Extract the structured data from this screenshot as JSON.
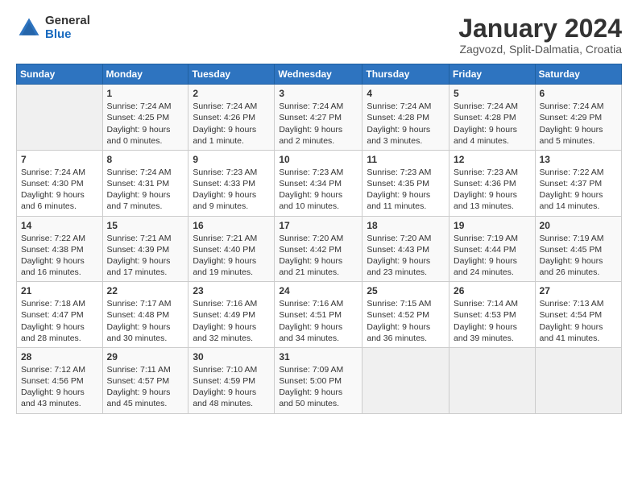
{
  "header": {
    "logo_general": "General",
    "logo_blue": "Blue",
    "month_title": "January 2024",
    "subtitle": "Zagvozd, Split-Dalmatia, Croatia"
  },
  "weekdays": [
    "Sunday",
    "Monday",
    "Tuesday",
    "Wednesday",
    "Thursday",
    "Friday",
    "Saturday"
  ],
  "weeks": [
    [
      {
        "num": "",
        "sunrise": "",
        "sunset": "",
        "daylight": ""
      },
      {
        "num": "1",
        "sunrise": "Sunrise: 7:24 AM",
        "sunset": "Sunset: 4:25 PM",
        "daylight": "Daylight: 9 hours and 0 minutes."
      },
      {
        "num": "2",
        "sunrise": "Sunrise: 7:24 AM",
        "sunset": "Sunset: 4:26 PM",
        "daylight": "Daylight: 9 hours and 1 minute."
      },
      {
        "num": "3",
        "sunrise": "Sunrise: 7:24 AM",
        "sunset": "Sunset: 4:27 PM",
        "daylight": "Daylight: 9 hours and 2 minutes."
      },
      {
        "num": "4",
        "sunrise": "Sunrise: 7:24 AM",
        "sunset": "Sunset: 4:28 PM",
        "daylight": "Daylight: 9 hours and 3 minutes."
      },
      {
        "num": "5",
        "sunrise": "Sunrise: 7:24 AM",
        "sunset": "Sunset: 4:28 PM",
        "daylight": "Daylight: 9 hours and 4 minutes."
      },
      {
        "num": "6",
        "sunrise": "Sunrise: 7:24 AM",
        "sunset": "Sunset: 4:29 PM",
        "daylight": "Daylight: 9 hours and 5 minutes."
      }
    ],
    [
      {
        "num": "7",
        "sunrise": "Sunrise: 7:24 AM",
        "sunset": "Sunset: 4:30 PM",
        "daylight": "Daylight: 9 hours and 6 minutes."
      },
      {
        "num": "8",
        "sunrise": "Sunrise: 7:24 AM",
        "sunset": "Sunset: 4:31 PM",
        "daylight": "Daylight: 9 hours and 7 minutes."
      },
      {
        "num": "9",
        "sunrise": "Sunrise: 7:23 AM",
        "sunset": "Sunset: 4:33 PM",
        "daylight": "Daylight: 9 hours and 9 minutes."
      },
      {
        "num": "10",
        "sunrise": "Sunrise: 7:23 AM",
        "sunset": "Sunset: 4:34 PM",
        "daylight": "Daylight: 9 hours and 10 minutes."
      },
      {
        "num": "11",
        "sunrise": "Sunrise: 7:23 AM",
        "sunset": "Sunset: 4:35 PM",
        "daylight": "Daylight: 9 hours and 11 minutes."
      },
      {
        "num": "12",
        "sunrise": "Sunrise: 7:23 AM",
        "sunset": "Sunset: 4:36 PM",
        "daylight": "Daylight: 9 hours and 13 minutes."
      },
      {
        "num": "13",
        "sunrise": "Sunrise: 7:22 AM",
        "sunset": "Sunset: 4:37 PM",
        "daylight": "Daylight: 9 hours and 14 minutes."
      }
    ],
    [
      {
        "num": "14",
        "sunrise": "Sunrise: 7:22 AM",
        "sunset": "Sunset: 4:38 PM",
        "daylight": "Daylight: 9 hours and 16 minutes."
      },
      {
        "num": "15",
        "sunrise": "Sunrise: 7:21 AM",
        "sunset": "Sunset: 4:39 PM",
        "daylight": "Daylight: 9 hours and 17 minutes."
      },
      {
        "num": "16",
        "sunrise": "Sunrise: 7:21 AM",
        "sunset": "Sunset: 4:40 PM",
        "daylight": "Daylight: 9 hours and 19 minutes."
      },
      {
        "num": "17",
        "sunrise": "Sunrise: 7:20 AM",
        "sunset": "Sunset: 4:42 PM",
        "daylight": "Daylight: 9 hours and 21 minutes."
      },
      {
        "num": "18",
        "sunrise": "Sunrise: 7:20 AM",
        "sunset": "Sunset: 4:43 PM",
        "daylight": "Daylight: 9 hours and 23 minutes."
      },
      {
        "num": "19",
        "sunrise": "Sunrise: 7:19 AM",
        "sunset": "Sunset: 4:44 PM",
        "daylight": "Daylight: 9 hours and 24 minutes."
      },
      {
        "num": "20",
        "sunrise": "Sunrise: 7:19 AM",
        "sunset": "Sunset: 4:45 PM",
        "daylight": "Daylight: 9 hours and 26 minutes."
      }
    ],
    [
      {
        "num": "21",
        "sunrise": "Sunrise: 7:18 AM",
        "sunset": "Sunset: 4:47 PM",
        "daylight": "Daylight: 9 hours and 28 minutes."
      },
      {
        "num": "22",
        "sunrise": "Sunrise: 7:17 AM",
        "sunset": "Sunset: 4:48 PM",
        "daylight": "Daylight: 9 hours and 30 minutes."
      },
      {
        "num": "23",
        "sunrise": "Sunrise: 7:16 AM",
        "sunset": "Sunset: 4:49 PM",
        "daylight": "Daylight: 9 hours and 32 minutes."
      },
      {
        "num": "24",
        "sunrise": "Sunrise: 7:16 AM",
        "sunset": "Sunset: 4:51 PM",
        "daylight": "Daylight: 9 hours and 34 minutes."
      },
      {
        "num": "25",
        "sunrise": "Sunrise: 7:15 AM",
        "sunset": "Sunset: 4:52 PM",
        "daylight": "Daylight: 9 hours and 36 minutes."
      },
      {
        "num": "26",
        "sunrise": "Sunrise: 7:14 AM",
        "sunset": "Sunset: 4:53 PM",
        "daylight": "Daylight: 9 hours and 39 minutes."
      },
      {
        "num": "27",
        "sunrise": "Sunrise: 7:13 AM",
        "sunset": "Sunset: 4:54 PM",
        "daylight": "Daylight: 9 hours and 41 minutes."
      }
    ],
    [
      {
        "num": "28",
        "sunrise": "Sunrise: 7:12 AM",
        "sunset": "Sunset: 4:56 PM",
        "daylight": "Daylight: 9 hours and 43 minutes."
      },
      {
        "num": "29",
        "sunrise": "Sunrise: 7:11 AM",
        "sunset": "Sunset: 4:57 PM",
        "daylight": "Daylight: 9 hours and 45 minutes."
      },
      {
        "num": "30",
        "sunrise": "Sunrise: 7:10 AM",
        "sunset": "Sunset: 4:59 PM",
        "daylight": "Daylight: 9 hours and 48 minutes."
      },
      {
        "num": "31",
        "sunrise": "Sunrise: 7:09 AM",
        "sunset": "Sunset: 5:00 PM",
        "daylight": "Daylight: 9 hours and 50 minutes."
      },
      {
        "num": "",
        "sunrise": "",
        "sunset": "",
        "daylight": ""
      },
      {
        "num": "",
        "sunrise": "",
        "sunset": "",
        "daylight": ""
      },
      {
        "num": "",
        "sunrise": "",
        "sunset": "",
        "daylight": ""
      }
    ]
  ]
}
